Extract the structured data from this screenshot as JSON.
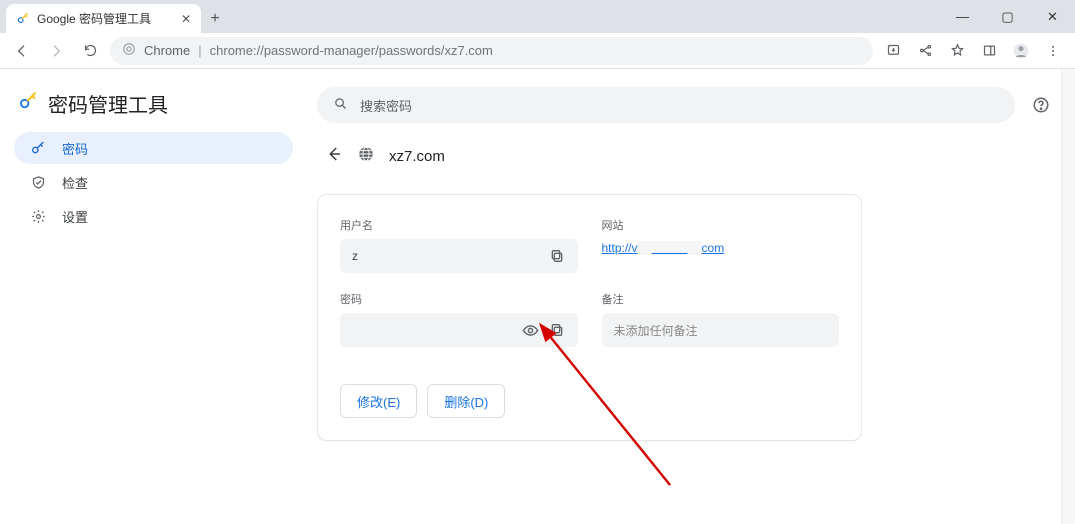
{
  "titlebar": {
    "tab_title": "Google 密码管理工具"
  },
  "toolbar": {
    "scheme_label": "Chrome",
    "url_path": "chrome://password-manager/passwords/xz7.com"
  },
  "app": {
    "title": "密码管理工具"
  },
  "sidebar": {
    "items": [
      {
        "label": "密码"
      },
      {
        "label": "检查"
      },
      {
        "label": "设置"
      }
    ]
  },
  "search": {
    "placeholder": "搜索密码"
  },
  "page": {
    "site": "xz7.com"
  },
  "detail": {
    "username_label": "用户名",
    "username_value": "z",
    "website_label": "网站",
    "website_link_prefix": "http://v",
    "website_link_suffix": "com",
    "password_label": "密码",
    "notes_label": "备注",
    "notes_placeholder": "未添加任何备注",
    "edit_btn": "修改(E)",
    "delete_btn": "删除(D)"
  }
}
